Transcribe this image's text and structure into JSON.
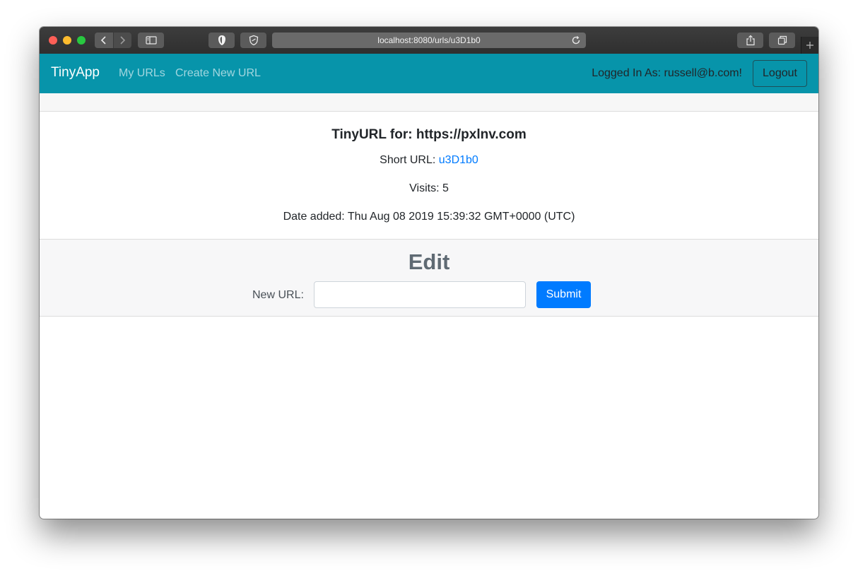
{
  "browser": {
    "address": "localhost:8080/urls/u3D1b0",
    "icons": {
      "back": "chevron-left-icon",
      "forward": "chevron-right-icon",
      "sidebar": "sidebar-icon",
      "privacy": "privacy-shield-icon",
      "extension": "extension-icon",
      "reload": "reload-icon",
      "share": "share-icon",
      "tabs": "tabs-overview-icon",
      "new_tab": "plus-icon"
    }
  },
  "navbar": {
    "brand": "TinyApp",
    "links": [
      "My URLs",
      "Create New URL"
    ],
    "logged_in_text": "Logged In As: russell@b.com!",
    "logout_label": "Logout",
    "colors": {
      "background": "#0794aa"
    }
  },
  "url_details": {
    "title": "TinyURL for: https://pxlnv.com",
    "short_url_label": "Short URL: ",
    "short_url": "u3D1b0",
    "visits": "Visits: 5",
    "date_added": "Date added: Thu Aug 08 2019 15:39:32 GMT+0000 (UTC)"
  },
  "edit": {
    "heading": "Edit",
    "field_label": "New URL:",
    "field_value": "",
    "field_placeholder": "",
    "submit_label": "Submit",
    "colors": {
      "submit": "#007bff",
      "link": "#007bff"
    }
  }
}
